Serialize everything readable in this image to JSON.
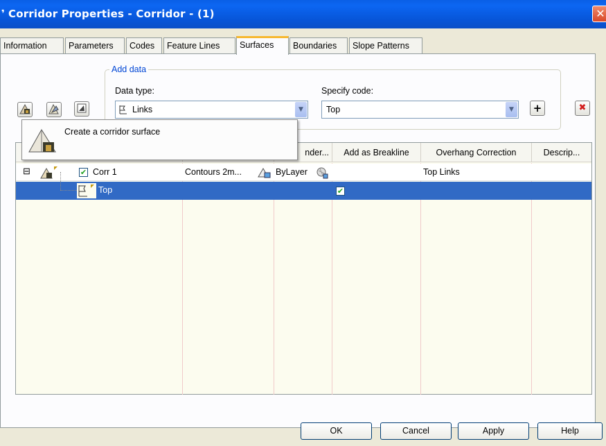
{
  "window": {
    "title": "Corridor Properties - Corridor - (1)",
    "close_glyph": "✕"
  },
  "tabs": [
    {
      "label": "Information"
    },
    {
      "label": "Parameters"
    },
    {
      "label": "Codes"
    },
    {
      "label": "Feature Lines"
    },
    {
      "label": "Surfaces",
      "active": true
    },
    {
      "label": "Boundaries"
    },
    {
      "label": "Slope Patterns"
    }
  ],
  "add_data": {
    "group_label": "Add data",
    "data_type_label": "Data type:",
    "data_type_value": "Links",
    "specify_code_label": "Specify code:",
    "specify_code_value": "Top"
  },
  "toolbar": {
    "icons": [
      "create-surface-icon",
      "add-surface-item-icon",
      "surface-style-icon"
    ],
    "add_button_glyph": "+",
    "delete_button_glyph": "✖"
  },
  "tooltip": {
    "text": "Create a corridor surface"
  },
  "grid": {
    "columns": [
      {
        "label": ""
      },
      {
        "label": ""
      },
      {
        "label": "nder..."
      },
      {
        "label": "Add as Breakline"
      },
      {
        "label": "Overhang Correction"
      },
      {
        "label": "Descrip..."
      }
    ],
    "rows": [
      {
        "expander": "⊟",
        "name": "Corr 1",
        "checked": true,
        "style": "Contours 2m...",
        "render": "ByLayer",
        "breakline": "",
        "overhang": "Top Links",
        "description": ""
      },
      {
        "name": "Top",
        "style": "",
        "render": "",
        "breakline_checked": true,
        "overhang": "",
        "description": ""
      }
    ]
  },
  "buttons": {
    "ok": "OK",
    "cancel": "Cancel",
    "apply": "Apply",
    "help": "Help"
  },
  "colors": {
    "titlebar": "#0755d8",
    "selection": "#316ac5",
    "tab_accent": "#f7b830",
    "groupbox_label": "#0046d5",
    "delete_red": "#d21e1e"
  }
}
